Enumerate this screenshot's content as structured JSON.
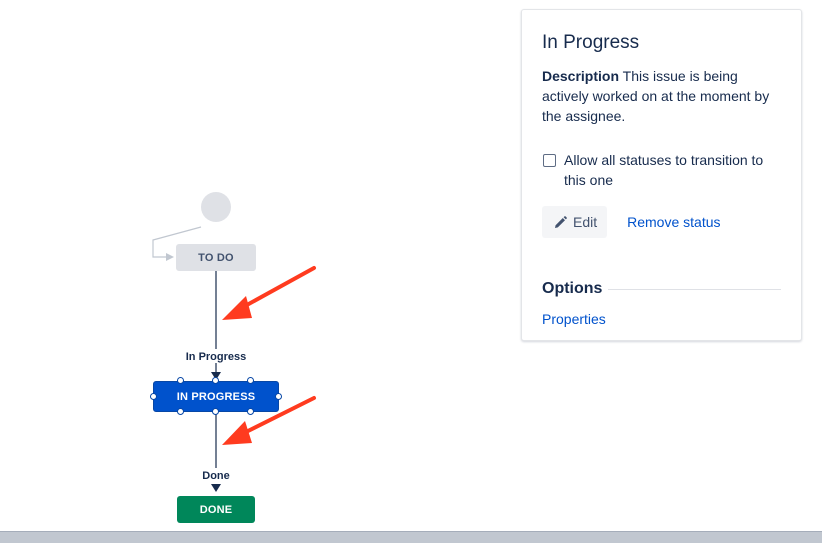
{
  "workflow": {
    "statuses": [
      {
        "id": "todo",
        "label": "TO DO",
        "category_color": "#dfe1e6"
      },
      {
        "id": "inprogress",
        "label": "IN PROGRESS",
        "category_color": "#0052cc",
        "selected": true
      },
      {
        "id": "done",
        "label": "DONE",
        "category_color": "#00875a"
      }
    ],
    "transitions": [
      {
        "label": "In Progress",
        "from": "todo",
        "to": "inprogress"
      },
      {
        "label": "Done",
        "from": "inprogress",
        "to": "done"
      }
    ],
    "annotation_color": "#ff3b1f"
  },
  "panel": {
    "title": "In Progress",
    "description_label": "Description",
    "description_text": "This issue is being actively worked on at the moment by the assignee.",
    "allow_all_label": "Allow all statuses to transition to this one",
    "allow_all_checked": false,
    "edit_label": "Edit",
    "remove_label": "Remove status",
    "options_title": "Options",
    "properties_label": "Properties"
  },
  "icons": {
    "edit": "pencil-icon"
  }
}
